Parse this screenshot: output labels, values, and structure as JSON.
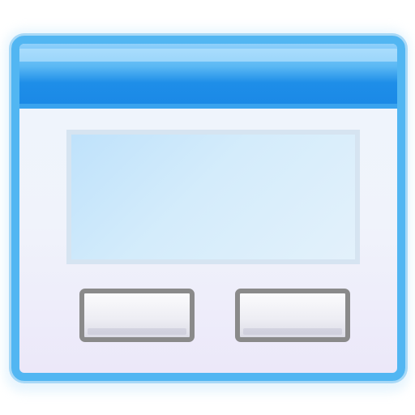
{
  "icon": {
    "name": "dialog-window-icon",
    "colors": {
      "frame": "#52b6f2",
      "title_bar": "#1a88e6",
      "content_panel": "#cfe8fb",
      "button_border": "#8a8a8a",
      "button_fill": "#ededf3",
      "window_background": "#eef3fb"
    }
  },
  "buttons": {
    "left_label": "",
    "right_label": ""
  }
}
